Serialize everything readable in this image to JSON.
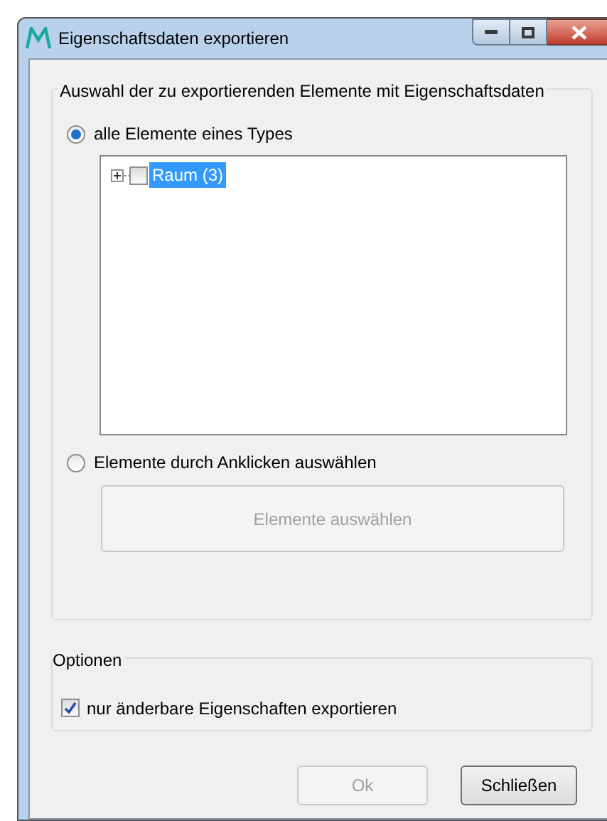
{
  "window": {
    "title": "Eigenschaftsdaten exportieren"
  },
  "selection_group": {
    "title": "Auswahl der zu exportierenden Elemente mit Eigenschaftsdaten",
    "options": [
      {
        "label": "alle Elemente eines Types",
        "selected": true
      },
      {
        "label": "Elemente durch Anklicken auswählen",
        "selected": false
      }
    ],
    "tree": [
      {
        "label": "Raum (3)",
        "expanded": false,
        "checked": false,
        "selected": true
      }
    ],
    "select_button": {
      "label": "Elemente auswählen",
      "disabled": true
    }
  },
  "options_group": {
    "title": "Optionen",
    "checkbox": {
      "label": "nur änderbare Eigenschaften exportieren",
      "checked": true
    }
  },
  "buttons": [
    {
      "label": "Ok",
      "disabled": true
    },
    {
      "label": "Schließen",
      "disabled": false
    }
  ]
}
